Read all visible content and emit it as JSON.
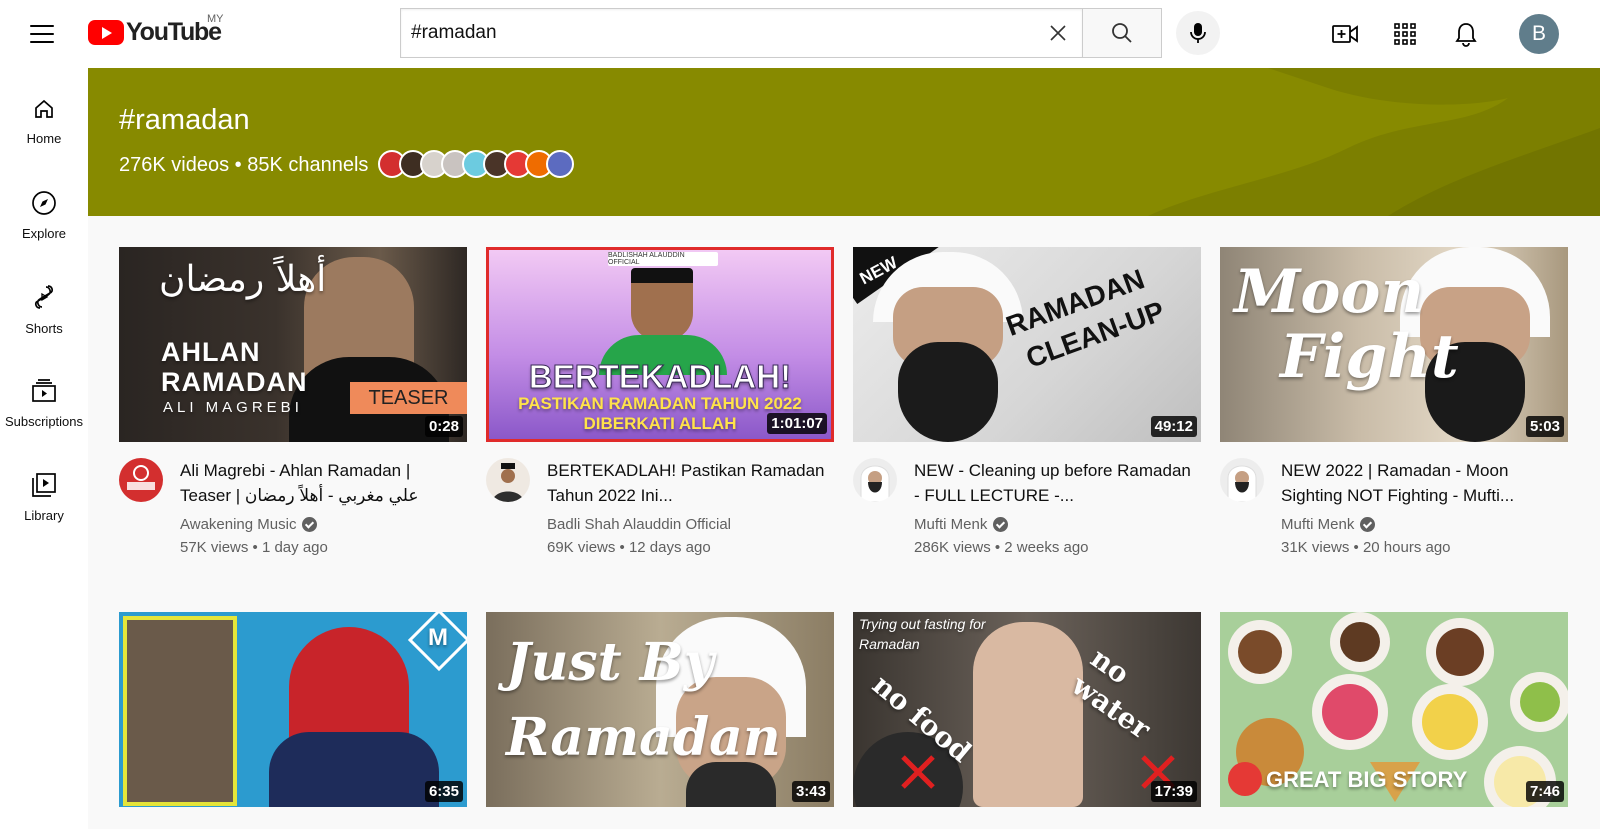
{
  "header": {
    "logo_text": "YouTube",
    "region": "MY",
    "search_value": "#ramadan",
    "avatar_letter": "B"
  },
  "sidebar": {
    "items": [
      {
        "label": "Home",
        "icon": "home-icon"
      },
      {
        "label": "Explore",
        "icon": "compass-icon"
      },
      {
        "label": "Shorts",
        "icon": "shorts-icon"
      },
      {
        "label": "Subscriptions",
        "icon": "subscriptions-icon"
      },
      {
        "label": "Library",
        "icon": "library-icon"
      }
    ]
  },
  "banner": {
    "title": "#ramadan",
    "stats": "276K videos • 85K channels",
    "color": "#878a00"
  },
  "videos": [
    {
      "title": "Ali Magrebi - Ahlan Ramadan | Teaser | علي مغربي - أهلاً رمضان",
      "channel": "Awakening Music",
      "stats": "57K views • 1 day ago",
      "duration": "0:28",
      "verified": true
    },
    {
      "title": "BERTEKADLAH! Pastikan Ramadan Tahun 2022 Ini...",
      "channel": "Badli Shah Alauddin Official",
      "stats": "69K views • 12 days ago",
      "duration": "1:01:07",
      "verified": false
    },
    {
      "title": "NEW - Cleaning up before Ramadan - FULL LECTURE -...",
      "channel": "Mufti Menk",
      "stats": "286K views • 2 weeks ago",
      "duration": "49:12",
      "verified": true
    },
    {
      "title": "NEW 2022 | Ramadan - Moon Sighting NOT Fighting - Mufti...",
      "channel": "Mufti Menk",
      "stats": "31K views • 20 hours ago",
      "duration": "5:03",
      "verified": true
    },
    {
      "title": "",
      "channel": "",
      "stats": "",
      "duration": "6:35",
      "verified": false
    },
    {
      "title": "",
      "channel": "",
      "stats": "",
      "duration": "3:43",
      "verified": false
    },
    {
      "title": "",
      "channel": "",
      "stats": "",
      "duration": "17:39",
      "verified": false
    },
    {
      "title": "",
      "channel": "",
      "stats": "",
      "duration": "7:46",
      "verified": false
    }
  ],
  "thumb_text": {
    "v1_arabic": "أهلاً رمضان",
    "v1_line1": "AHLAN",
    "v1_line2": "RAMADAN",
    "v1_line3": "ALI MAGREBI",
    "v1_badge": "TEASER",
    "v2_top": "BADLISHAH ALAUDDIN OFFICIAL",
    "v2_line1": "BERTEKADLAH!",
    "v2_line2": "PASTIKAN RAMADAN TAHUN 2022",
    "v2_line3": "DIBERKATI ALLAH",
    "v3_new": "NEW",
    "v3_line1": "RAMADAN",
    "v3_line2": "CLEAN-UP",
    "v4_line1": "Moon",
    "v4_line2": "Fight",
    "v5_logo": "M",
    "v6_line1": "Just By",
    "v6_line2": "Ramadan",
    "v7_caption": "Trying out fasting for Ramadan",
    "v7_left": "no food",
    "v7_right": "no water",
    "v8_brand": "GREAT BIG STORY"
  }
}
